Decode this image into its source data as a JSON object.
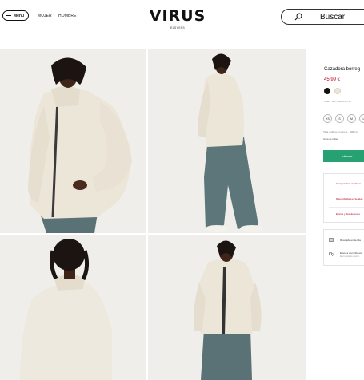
{
  "header": {
    "menu_label": "Menu",
    "nav": [
      "MUJER",
      "HOMBRE"
    ],
    "logo_text": "VIRUS",
    "logo_sub": "ELSYSSS",
    "search_label": "Buscar"
  },
  "product": {
    "name": "Cazadora borreg",
    "price": "45,99 €",
    "colors": [
      "#111111",
      "#ece6d9"
    ],
    "ref": "Color · Ref. 6639/PH/710",
    "sizes": [
      "XS",
      "S",
      "M",
      "L"
    ],
    "size_guide": "Talla y altura modelo 1... 188 cm",
    "size_info": "Guía de tallas",
    "add_button": "AÑADIR",
    "accordion": [
      "Composición, cuidados",
      "Disponibilidad en tiendas",
      "Envíos y devoluciones"
    ],
    "services": [
      {
        "title": "Recogida en tienda",
        "sub": ""
      },
      {
        "title": "Envío a domicilio est",
        "sub": "Envío gratuito a partir..."
      }
    ]
  },
  "colors": {
    "accent_green": "#27a172",
    "price_red": "#b3001b",
    "jacket_cream": "#ece6d9",
    "denim": "#5a7276"
  }
}
